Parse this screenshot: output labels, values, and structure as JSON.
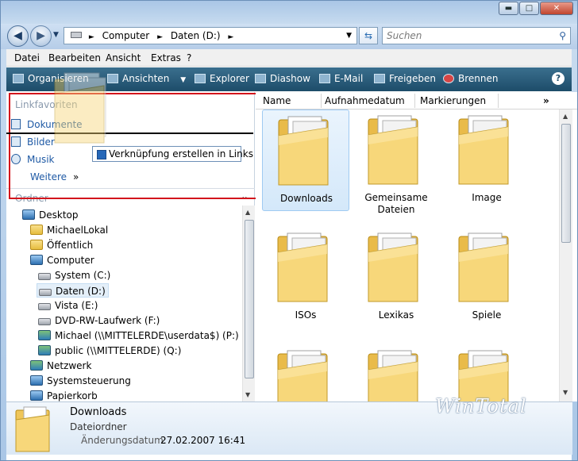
{
  "window": {
    "minimize_glyph": "▬",
    "maximize_glyph": "□",
    "close_glyph": "✕"
  },
  "address": {
    "segments": [
      "Computer",
      "Daten (D:)"
    ],
    "search_placeholder": "Suchen"
  },
  "menu": [
    "Datei",
    "Bearbeiten",
    "Ansicht",
    "Extras",
    "?"
  ],
  "toolbar": [
    "Organisieren",
    "Ansichten",
    "Explorer",
    "Diashow",
    "E-Mail",
    "Freigeben",
    "Brennen"
  ],
  "links": {
    "header": "Linkfavoriten",
    "items": [
      "Dokumente",
      "Bilder",
      "Musik"
    ],
    "more": "Weitere",
    "more_glyph": "»",
    "tooltip": "Verknüpfung erstellen in Links"
  },
  "ordner": {
    "label": "Ordner",
    "glyph": "⌄"
  },
  "tree": [
    {
      "label": "Desktop",
      "icon": "desktop-icon"
    },
    {
      "label": "MichaelLokal",
      "icon": "user-folder-icon"
    },
    {
      "label": "Öffentlich",
      "icon": "public-folder-icon"
    },
    {
      "label": "Computer",
      "icon": "computer-icon"
    },
    {
      "label": "System (C:)",
      "icon": "drive-icon"
    },
    {
      "label": "Daten (D:)",
      "icon": "drive-icon"
    },
    {
      "label": "Vista (E:)",
      "icon": "drive-icon"
    },
    {
      "label": "DVD-RW-Laufwerk (F:)",
      "icon": "dvd-drive-icon"
    },
    {
      "label": "Michael (\\\\MITTELERDE\\userdata$) (P:)",
      "icon": "network-drive-icon"
    },
    {
      "label": "public (\\\\MITTELERDE) (Q:)",
      "icon": "network-drive-icon"
    },
    {
      "label": "Netzwerk",
      "icon": "network-icon"
    },
    {
      "label": "Systemsteuerung",
      "icon": "control-panel-icon"
    },
    {
      "label": "Papierkorb",
      "icon": "recycle-bin-icon"
    }
  ],
  "columns": [
    "Name",
    "Aufnahmedatum",
    "Markierungen"
  ],
  "columns_more": "»",
  "folders": [
    {
      "name": "Downloads",
      "selected": true
    },
    {
      "name": "Gemeinsame Dateien",
      "selected": false
    },
    {
      "name": "Image",
      "selected": false
    },
    {
      "name": "ISOs",
      "selected": false
    },
    {
      "name": "Lexikas",
      "selected": false
    },
    {
      "name": "Spiele",
      "selected": false
    },
    {
      "name": "",
      "selected": false
    },
    {
      "name": "",
      "selected": false
    },
    {
      "name": "",
      "selected": false
    }
  ],
  "details": {
    "name": "Downloads",
    "type": "Dateiordner",
    "date_label": "Änderungsdatum:",
    "date_value": "27.02.2007 16:41"
  },
  "watermark": "WinTotal"
}
